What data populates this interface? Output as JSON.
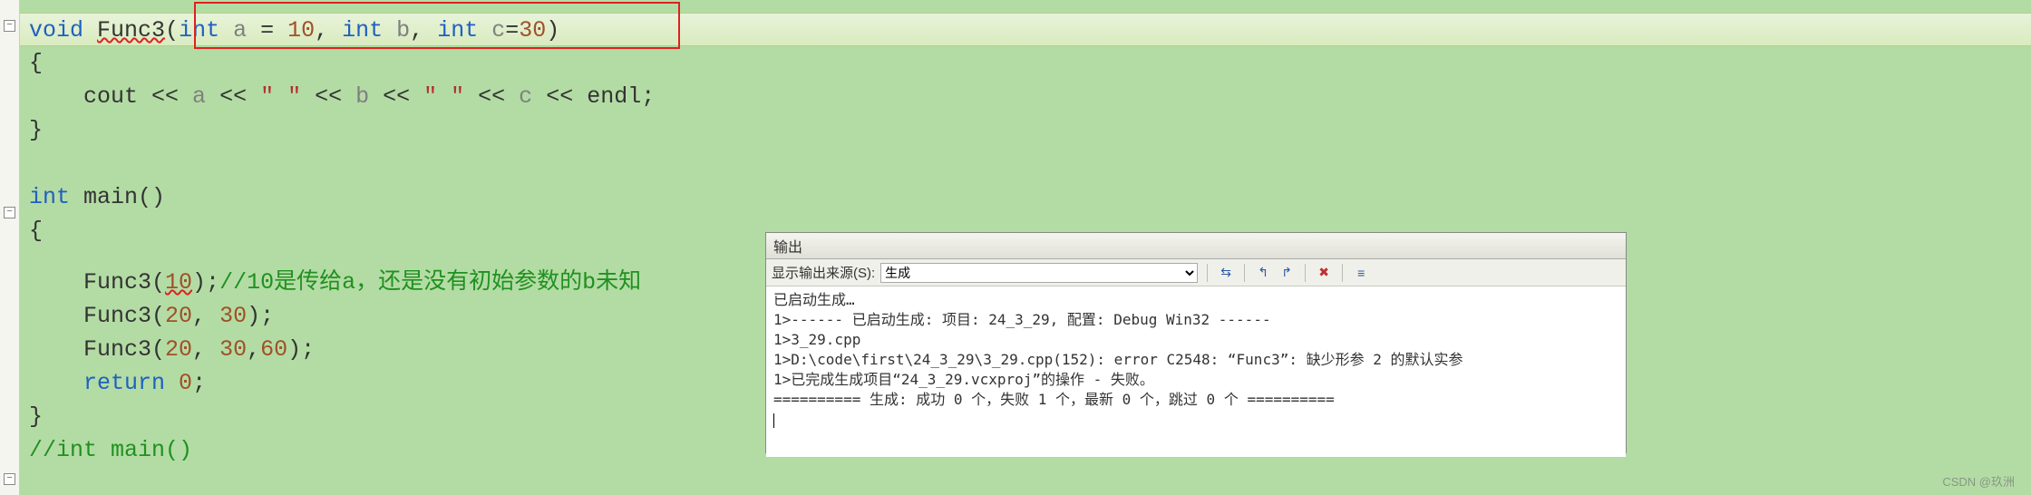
{
  "code": {
    "l1_kw_void": "void",
    "l1_fn": "Func3",
    "l1_p_int1": "int",
    "l1_p_a": " a ",
    "l1_eq1": "= ",
    "l1_v1": "10",
    "l1_c1": ", ",
    "l1_p_int2": "int",
    "l1_p_b": " b",
    "l1_c2": ", ",
    "l1_p_int3": "int",
    "l1_p_c": " c",
    "l1_eq2": "=",
    "l1_v3": "30",
    "l2": "{",
    "l3_cout": "    cout ",
    "l3_a": "a ",
    "l3_s1": "\" \"",
    "l3_b": "b ",
    "l3_s2": "\" \" ",
    "l3_c": "c ",
    "l3_endl": "endl",
    "l3_semi": ";",
    "l4": "}",
    "l5_kw_int": "int",
    "l5_main": " main()",
    "l6": "{",
    "l7_call": "    Func3(",
    "l7_arg": "10",
    "l7_close": ");",
    "l7_comment": "//10是传给a，还是没有初始参数的b未知",
    "l8_call": "    Func3(",
    "l8_a1": "20",
    "l8_c": ", ",
    "l8_a2": "30",
    "l8_close": ");",
    "l9_call": "    Func3(",
    "l9_a1": "20",
    "l9_c1": ", ",
    "l9_a2": "30",
    "l9_c2": ",",
    "l9_a3": "60",
    "l9_close": ");",
    "l10_ret": "    return",
    "l10_sp": " ",
    "l10_v": "0",
    "l10_semi": ";",
    "l11": "}",
    "l12": "//int main()"
  },
  "output": {
    "title": "输出",
    "source_label": "显示输出来源(S):",
    "source_value": "生成",
    "lines": [
      "已启动生成…",
      "1>------ 已启动生成: 项目: 24_3_29, 配置: Debug Win32 ------",
      "1>3_29.cpp",
      "1>D:\\code\\first\\24_3_29\\3_29.cpp(152): error C2548: “Func3”: 缺少形参 2 的默认实参",
      "1>已完成生成项目“24_3_29.vcxproj”的操作 - 失败。",
      "========== 生成: 成功 0 个，失败 1 个，最新 0 个，跳过 0 个 =========="
    ]
  },
  "watermark": "CSDN @玖洲"
}
